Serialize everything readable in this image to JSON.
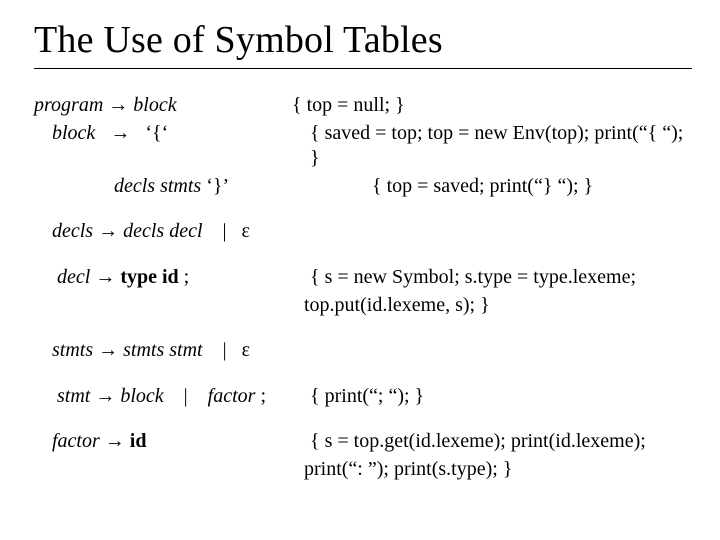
{
  "title": "The Use of Symbol Tables",
  "rules": {
    "program": {
      "lhs": "program",
      "arrow": "→",
      "rhs": "block",
      "action": "{ top = null; }"
    },
    "block1": {
      "lhs": "block",
      "arrow": "→",
      "rhs": "‘{‘",
      "action": "{ saved = top; top = new Env(top); print(“{ “); }"
    },
    "block2": {
      "rhs_pre": "decls stmts",
      "rhs_tail": " ‘}’",
      "action": "{ top = saved; print(“} “); }"
    },
    "decls": {
      "lhs": "decls",
      "arrow": "→",
      "rhs": "decls  decl",
      "bar": "|",
      "eps": "ε"
    },
    "decl": {
      "lhs": "decl",
      "arrow": "→",
      "rhs_kw": "type id",
      "rhs_tail": " ;",
      "action1": "{  s = new Symbol; s.type = type.lexeme;",
      "action2": "top.put(id.lexeme, s); }"
    },
    "stmts": {
      "lhs": "stmts",
      "arrow": "→",
      "rhs": "stmts stmt",
      "bar": "|",
      "eps": "ε"
    },
    "stmt": {
      "lhs": "stmt",
      "arrow": "→",
      "rhs1": "block",
      "bar": "|",
      "rhs2": "factor",
      "rhs_tail": " ;",
      "action": "{ print(“; “); }"
    },
    "factor": {
      "lhs": "factor",
      "arrow": "→",
      "rhs_kw": "id",
      "action1": "{ s = top.get(id.lexeme);  print(id.lexeme);",
      "action2": "print(“: ”);   print(s.type); }"
    }
  }
}
